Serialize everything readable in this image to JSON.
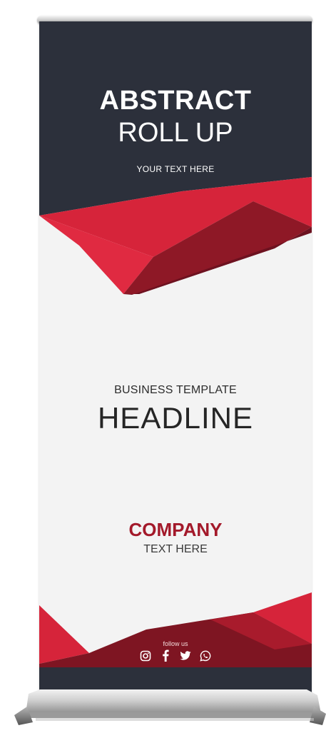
{
  "banner": {
    "title_main": "ABSTRACT",
    "title_sub": "ROLL UP",
    "tagline": "YOUR TEXT HERE",
    "business_label": "BUSINESS TEMPLATE",
    "headline": "HEADLINE",
    "company": "COMPANY",
    "company_text": "TEXT HERE",
    "follow_label": "follow us",
    "social_icons": [
      "instagram-icon",
      "facebook-icon",
      "twitter-icon",
      "whatsapp-icon"
    ]
  },
  "colors": {
    "dark": "#2c303b",
    "red": "#d6243a",
    "dark_red": "#7e1522",
    "background": "#f3f3f3"
  }
}
